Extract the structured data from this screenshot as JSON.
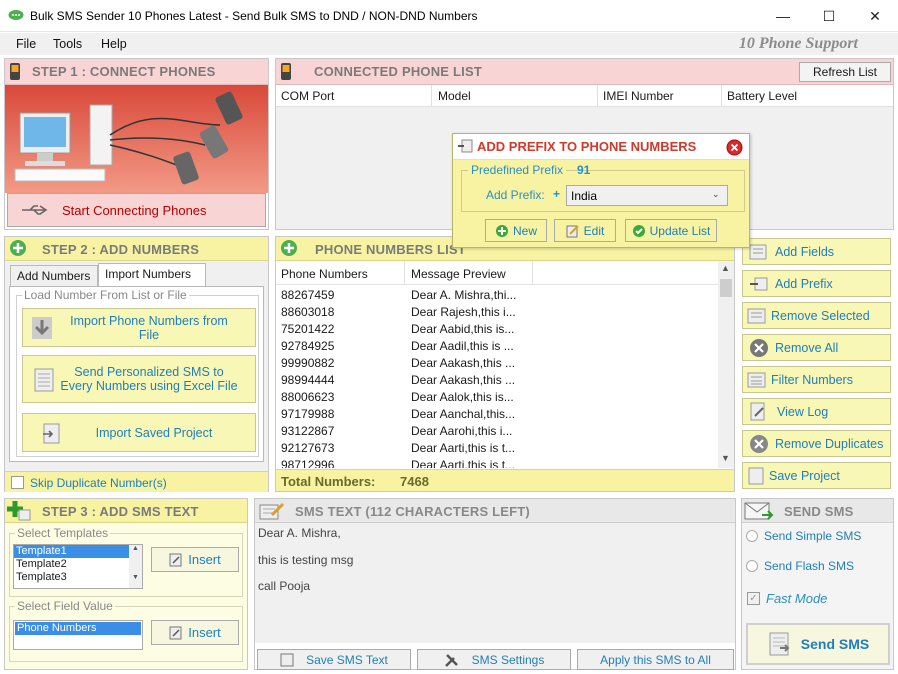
{
  "window": {
    "title": "Bulk SMS Sender 10 Phones Latest - Send Bulk SMS to DND / NON-DND Numbers",
    "minimize": "—",
    "maximize": "☐",
    "close": "✕"
  },
  "menu": [
    "File",
    "Tools",
    "Help"
  ],
  "support_label": "10 Phone Support",
  "step1": {
    "title": "STEP 1 : CONNECT PHONES",
    "button": "Start Connecting Phones"
  },
  "connected": {
    "title": "CONNECTED PHONE LIST",
    "refresh": "Refresh List",
    "columns": [
      "COM  Port",
      "Model",
      "IMEI Number",
      "Battery Level"
    ]
  },
  "prefix_dialog": {
    "title": "ADD PREFIX TO PHONE NUMBERS",
    "predefined_label": "Predefined Prefix",
    "predefined_value": "91",
    "add_prefix_label": "Add Prefix:",
    "plus": "+",
    "country": "India",
    "new": "New",
    "edit": "Edit",
    "update": "Update List"
  },
  "step2": {
    "title": "STEP 2 : ADD NUMBERS",
    "tab1": "Add Numbers",
    "tab2": "Import Numbers",
    "group": "Load Number From List or File",
    "btn1": "Import Phone Numbers from File",
    "btn2": "Send Personalized SMS to Every Numbers using Excel File",
    "btn3": "Import Saved Project",
    "skip": "Skip Duplicate Number(s)"
  },
  "phone_list": {
    "title": "PHONE NUMBERS LIST",
    "col1": "Phone Numbers",
    "col2": "Message Preview",
    "rows": [
      [
        "88267459",
        "Dear A. Mishra,thi..."
      ],
      [
        "88603018",
        "Dear Rajesh,this i..."
      ],
      [
        "75201422",
        "Dear Aabid,this is..."
      ],
      [
        "92784925",
        "Dear Aadil,this is ..."
      ],
      [
        "99990882",
        "Dear Aakash,this ..."
      ],
      [
        "98994444",
        "Dear Aakash,this ..."
      ],
      [
        "88006623",
        "Dear Aalok,this is..."
      ],
      [
        "97179988",
        "Dear Aanchal,this..."
      ],
      [
        "93122867",
        "Dear Aarohi,this i..."
      ],
      [
        "92127673",
        "Dear Aarti,this is t..."
      ],
      [
        "98712996",
        "Dear Aarti,this is t..."
      ]
    ],
    "total_label": "Total Numbers:",
    "total_value": "7468"
  },
  "side_buttons": [
    "Add Fields",
    "Add Prefix",
    "Remove Selected",
    "Remove All",
    "Filter Numbers",
    "View Log",
    "Remove Duplicates",
    "Save Project"
  ],
  "step3": {
    "title": "STEP 3 : ADD SMS TEXT",
    "templates_label": "Select Templates",
    "templates": [
      "Template1",
      "Template2",
      "Template3"
    ],
    "insert": "Insert",
    "field_label": "Select Field Value",
    "field_value": "Phone Numbers",
    "insert2": "Insert"
  },
  "sms_text": {
    "title": "SMS TEXT (112 CHARACTERS LEFT)",
    "lines": [
      "Dear A. Mishra,",
      "this is testing msg",
      "call Pooja"
    ],
    "save": "Save SMS Text",
    "settings": "SMS Settings",
    "apply": "Apply this SMS to All"
  },
  "send": {
    "title": "SEND SMS",
    "simple": "Send Simple SMS",
    "flash": "Send Flash SMS",
    "fast": "Fast Mode",
    "button": "Send SMS"
  },
  "colors": {
    "accent": "#1f7fb8",
    "yellow": "#f7f3a3",
    "pink": "#f8d4d4",
    "red_title": "#d03a2c"
  }
}
